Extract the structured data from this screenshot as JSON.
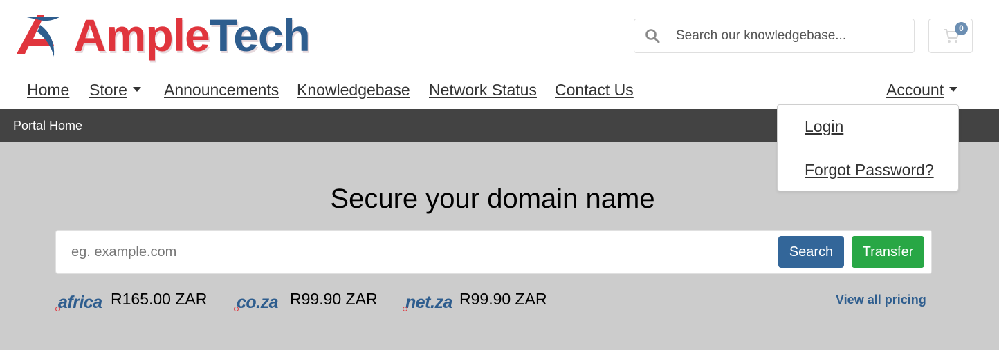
{
  "brand": {
    "name_part1": "Ample",
    "name_part2": "Tech"
  },
  "search": {
    "placeholder": "Search our knowledgebase..."
  },
  "cart": {
    "count": "0"
  },
  "nav": {
    "home": "Home",
    "store": "Store",
    "announcements": "Announcements",
    "knowledgebase": "Knowledgebase",
    "network_status": "Network Status",
    "contact_us": "Contact Us",
    "account": "Account"
  },
  "breadcrumb": {
    "current": "Portal Home"
  },
  "account_menu": {
    "login": "Login",
    "forgot_password": "Forgot Password?"
  },
  "hero": {
    "title": "Secure your domain name",
    "domain_placeholder": "eg. example.com",
    "search_button": "Search",
    "transfer_button": "Transfer"
  },
  "tlds": [
    {
      "logo": "africa",
      "price": "R165.00 ZAR"
    },
    {
      "logo": "co.za",
      "price": "R99.90 ZAR"
    },
    {
      "logo": "net.za",
      "price": "R99.90 ZAR"
    }
  ],
  "view_all_pricing": "View all pricing",
  "colors": {
    "brand_red": "#e0353d",
    "brand_blue": "#2e5d8e",
    "search_btn": "#336699",
    "transfer_btn": "#28a745"
  }
}
